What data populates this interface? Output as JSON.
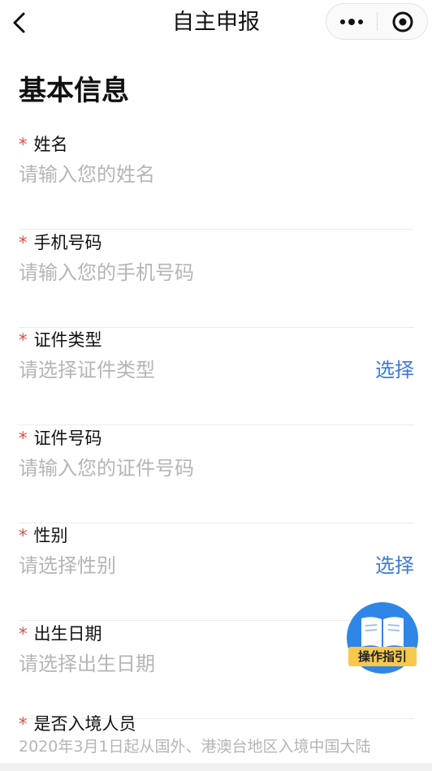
{
  "nav": {
    "title": "自主申报"
  },
  "section": {
    "title": "基本信息"
  },
  "required_mark": "*",
  "fields": {
    "name": {
      "label": "姓名",
      "placeholder": "请输入您的姓名"
    },
    "phone": {
      "label": "手机号码",
      "placeholder": "请输入您的手机号码"
    },
    "id_type": {
      "label": "证件类型",
      "placeholder": "请选择证件类型",
      "action": "选择"
    },
    "id_number": {
      "label": "证件号码",
      "placeholder": "请输入您的证件号码"
    },
    "gender": {
      "label": "性别",
      "placeholder": "请选择性别",
      "action": "选择"
    },
    "birthdate": {
      "label": "出生日期",
      "placeholder": "请选择出生日期"
    },
    "entry": {
      "label": "是否入境人员",
      "note": "2020年3月1日起从国外、港澳台地区入境中国大陆"
    }
  },
  "guide": {
    "label": "操作指引"
  },
  "colors": {
    "required": "#e84a3c",
    "link": "#3b7bd8",
    "placeholder": "#b5b5b5",
    "guide_blue": "#2f86e6",
    "guide_yellow": "#f6c94d"
  },
  "icons": {
    "back": "chevron-left-icon",
    "more": "more-dots-icon",
    "target": "target-icon",
    "guide": "book-icon"
  }
}
